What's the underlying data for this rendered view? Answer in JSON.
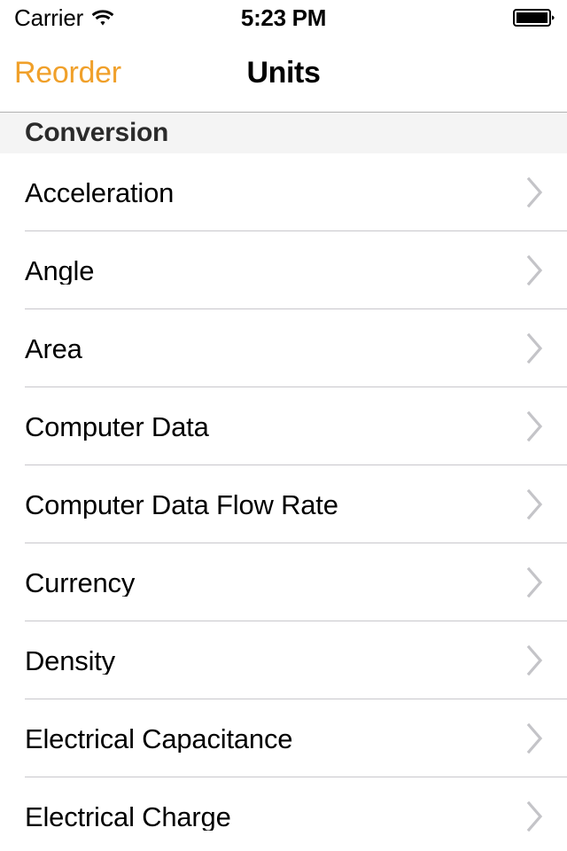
{
  "status_bar": {
    "carrier": "Carrier",
    "wifi_icon": "wifi-icon",
    "time": "5:23 PM",
    "battery_icon": "battery-full-icon"
  },
  "nav_bar": {
    "back_label": "Reorder",
    "title": "Units",
    "accent_color": "#f0a02a"
  },
  "section": {
    "header": "Conversion",
    "rows": [
      {
        "label": "Acceleration",
        "accessory": "chevron-right-icon"
      },
      {
        "label": "Angle",
        "accessory": "chevron-right-icon"
      },
      {
        "label": "Area",
        "accessory": "chevron-right-icon"
      },
      {
        "label": "Computer Data",
        "accessory": "chevron-right-icon"
      },
      {
        "label": "Computer Data Flow Rate",
        "accessory": "chevron-right-icon"
      },
      {
        "label": "Currency",
        "accessory": "chevron-right-icon"
      },
      {
        "label": "Density",
        "accessory": "chevron-right-icon"
      },
      {
        "label": "Electrical Capacitance",
        "accessory": "chevron-right-icon"
      },
      {
        "label": "Electrical Charge",
        "accessory": "chevron-right-icon"
      }
    ]
  }
}
